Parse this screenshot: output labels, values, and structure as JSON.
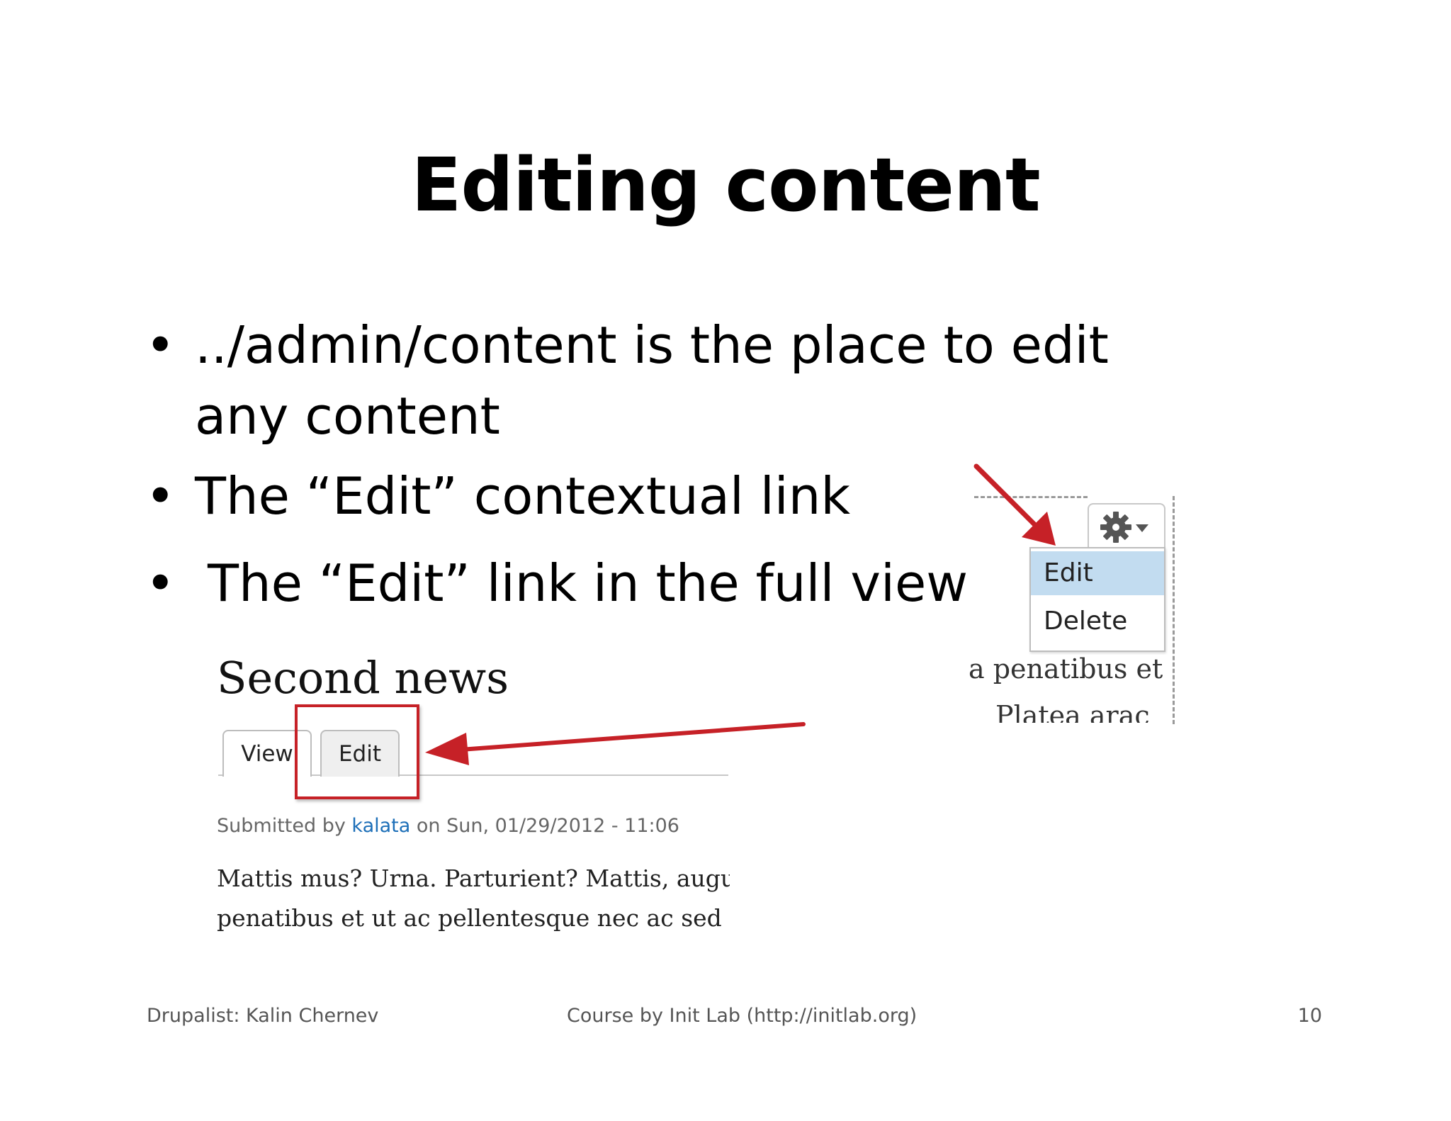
{
  "slide": {
    "title": "Editing content",
    "bullets": [
      {
        "marker": "•",
        "text": "../admin/content is the place to edit any content"
      },
      {
        "marker": "•",
        "text": "The “Edit” contextual link"
      },
      {
        "marker": "•",
        "text": "The “Edit” link in the full view"
      }
    ]
  },
  "full_view": {
    "node_title": "Second news",
    "tabs": {
      "view": "View",
      "edit": "Edit"
    },
    "submitted_prefix": "Submitted by",
    "author": "kalata",
    "submitted_suffix": "on Sun, 01/29/2012 - 11:06",
    "body_line1": "Mattis mus? Urna. Parturient? Mattis, augu",
    "body_line2": "penatibus et ut ac pellentesque nec ac sed m"
  },
  "contextual": {
    "menu": {
      "edit": "Edit",
      "delete": "Delete"
    },
    "bg_line1": "a penatibus et",
    "bg_line2": "Platea arac"
  },
  "footer": {
    "left": "Drupalist: Kalin Chernev",
    "center": "Course by Init Lab (http://initlab.org)",
    "page_number": "10"
  },
  "colors": {
    "highlight_red": "#c62127",
    "link_blue": "#1d6fb8",
    "menu_highlight": "#c2dcf0"
  }
}
